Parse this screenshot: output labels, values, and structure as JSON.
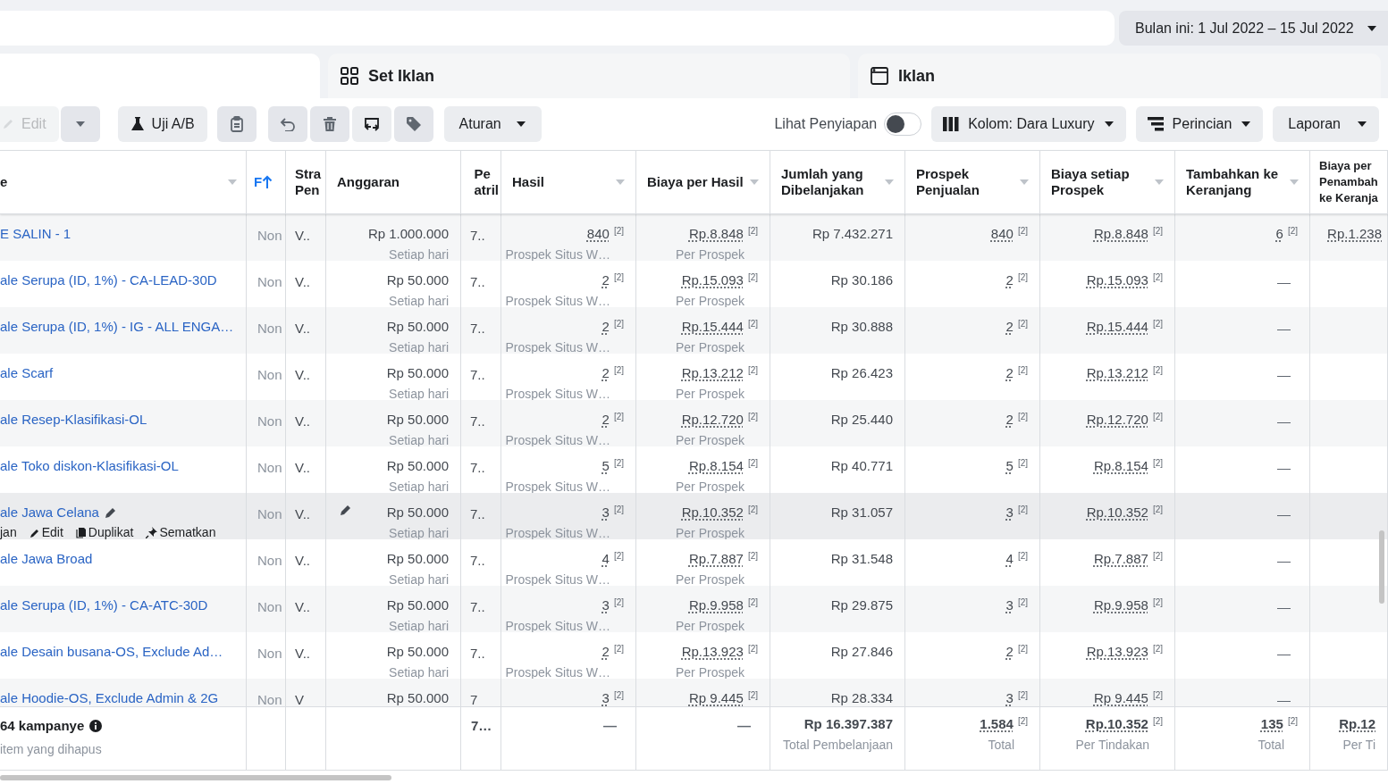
{
  "date_range": {
    "label": "Bulan ini: 1 Jul 2022 – 15 Jul 2022"
  },
  "tabs": [
    {
      "label": "Set Iklan"
    },
    {
      "label": "Iklan"
    }
  ],
  "toolbar": {
    "left": [
      {
        "kind": "edit",
        "label": "Edit",
        "disabled": true
      },
      {
        "kind": "caret",
        "disabled": false
      },
      {
        "kind": "abtest",
        "label": "Uji A/B",
        "disabled": false
      },
      {
        "kind": "clipboard",
        "disabled": false
      },
      {
        "kind": "undo",
        "disabled": false
      },
      {
        "kind": "trash",
        "disabled": false
      },
      {
        "kind": "swap",
        "disabled": false
      },
      {
        "kind": "tag",
        "disabled": false
      },
      {
        "kind": "dropdown",
        "label": "Aturan",
        "disabled": false
      }
    ],
    "setup_toggle": {
      "label": "Lihat Penyiapan",
      "on": false
    },
    "right": [
      {
        "label": "Kolom: Dara Luxury"
      },
      {
        "label": "Perincian"
      },
      {
        "label": "Laporan"
      }
    ]
  },
  "table": {
    "name_column": {
      "label": "e",
      "menu": true
    },
    "columns": [
      {
        "label": "F",
        "menu": false,
        "sorted": true
      },
      {
        "label": "Stra\nPen",
        "menu": false,
        "sorted": false
      },
      {
        "label": "Anggaran",
        "menu": false,
        "sorted": false
      },
      {
        "label": "Pe\natril",
        "menu": false,
        "sorted": false
      },
      {
        "label": "Hasil",
        "menu": true,
        "sorted": false
      },
      {
        "label": "Biaya per Hasil",
        "menu": true,
        "sorted": false
      },
      {
        "label": "Jumlah yang\nDibelanjakan",
        "menu": true,
        "sorted": false
      },
      {
        "label": "Prospek\nPenjualan",
        "menu": true,
        "sorted": false
      },
      {
        "label": "Biaya setiap\nProspek",
        "menu": true,
        "sorted": false
      },
      {
        "label": "Tambahkan ke\nKeranjang",
        "menu": true,
        "sorted": false
      },
      {
        "label": "Biaya per\nPenambah\nke Keranja",
        "menu": false,
        "sorted": false
      }
    ],
    "rows": [
      {
        "name": "E SALIN - 1",
        "hovered": false,
        "cells": [
          {
            "kind": "status",
            "text": "Non"
          },
          {
            "kind": "text",
            "text": "V.."
          },
          {
            "kind": "budget",
            "text": "Rp 1.000.000",
            "sub": "Setiap hari"
          },
          {
            "kind": "text",
            "text": "7.."
          },
          {
            "kind": "metric",
            "text": "840",
            "note": "[2]",
            "sub": "Prospek Situs W…"
          },
          {
            "kind": "metric",
            "text": "Rp.8.848",
            "note": "[2]",
            "sub": "Per Prospek"
          },
          {
            "kind": "amount",
            "text": "Rp 7.432.271"
          },
          {
            "kind": "metric",
            "text": "840",
            "note": "[2]"
          },
          {
            "kind": "metric",
            "text": "Rp.8.848",
            "note": "[2]"
          },
          {
            "kind": "metric",
            "text": "6",
            "note": "[2]"
          },
          {
            "kind": "metric",
            "text": "Rp.1.238"
          }
        ]
      },
      {
        "name": "ale Serupa (ID, 1%) - CA-LEAD-30D",
        "hovered": false,
        "cells": [
          {
            "kind": "status",
            "text": "Non"
          },
          {
            "kind": "text",
            "text": "V.."
          },
          {
            "kind": "budget",
            "text": "Rp 50.000",
            "sub": "Setiap hari"
          },
          {
            "kind": "text",
            "text": "7.."
          },
          {
            "kind": "metric",
            "text": "2",
            "note": "[2]",
            "sub": "Prospek Situs W…"
          },
          {
            "kind": "metric",
            "text": "Rp.15.093",
            "note": "[2]",
            "sub": "Per Prospek"
          },
          {
            "kind": "amount",
            "text": "Rp 30.186"
          },
          {
            "kind": "metric",
            "text": "2",
            "note": "[2]"
          },
          {
            "kind": "metric",
            "text": "Rp.15.093",
            "note": "[2]"
          },
          {
            "kind": "dash",
            "text": "—"
          },
          {
            "kind": "empty"
          }
        ]
      },
      {
        "name": "ale Serupa (ID, 1%) - IG - ALL ENGA…",
        "hovered": false,
        "cells": [
          {
            "kind": "status",
            "text": "Non"
          },
          {
            "kind": "text",
            "text": "V.."
          },
          {
            "kind": "budget",
            "text": "Rp 50.000",
            "sub": "Setiap hari"
          },
          {
            "kind": "text",
            "text": "7.."
          },
          {
            "kind": "metric",
            "text": "2",
            "note": "[2]",
            "sub": "Prospek Situs W…"
          },
          {
            "kind": "metric",
            "text": "Rp.15.444",
            "note": "[2]",
            "sub": "Per Prospek"
          },
          {
            "kind": "amount",
            "text": "Rp 30.888"
          },
          {
            "kind": "metric",
            "text": "2",
            "note": "[2]"
          },
          {
            "kind": "metric",
            "text": "Rp.15.444",
            "note": "[2]"
          },
          {
            "kind": "dash",
            "text": "—"
          },
          {
            "kind": "empty"
          }
        ]
      },
      {
        "name": "ale Scarf",
        "hovered": false,
        "cells": [
          {
            "kind": "status",
            "text": "Non"
          },
          {
            "kind": "text",
            "text": "V.."
          },
          {
            "kind": "budget",
            "text": "Rp 50.000",
            "sub": "Setiap hari"
          },
          {
            "kind": "text",
            "text": "7.."
          },
          {
            "kind": "metric",
            "text": "2",
            "note": "[2]",
            "sub": "Prospek Situs W…"
          },
          {
            "kind": "metric",
            "text": "Rp.13.212",
            "note": "[2]",
            "sub": "Per Prospek"
          },
          {
            "kind": "amount",
            "text": "Rp 26.423"
          },
          {
            "kind": "metric",
            "text": "2",
            "note": "[2]"
          },
          {
            "kind": "metric",
            "text": "Rp.13.212",
            "note": "[2]"
          },
          {
            "kind": "dash",
            "text": "—"
          },
          {
            "kind": "empty"
          }
        ]
      },
      {
        "name": "ale Resep-Klasifikasi-OL",
        "hovered": false,
        "cells": [
          {
            "kind": "status",
            "text": "Non"
          },
          {
            "kind": "text",
            "text": "V.."
          },
          {
            "kind": "budget",
            "text": "Rp 50.000",
            "sub": "Setiap hari"
          },
          {
            "kind": "text",
            "text": "7.."
          },
          {
            "kind": "metric",
            "text": "2",
            "note": "[2]",
            "sub": "Prospek Situs W…"
          },
          {
            "kind": "metric",
            "text": "Rp.12.720",
            "note": "[2]",
            "sub": "Per Prospek"
          },
          {
            "kind": "amount",
            "text": "Rp 25.440"
          },
          {
            "kind": "metric",
            "text": "2",
            "note": "[2]"
          },
          {
            "kind": "metric",
            "text": "Rp.12.720",
            "note": "[2]"
          },
          {
            "kind": "dash",
            "text": "—"
          },
          {
            "kind": "empty"
          }
        ]
      },
      {
        "name": "ale Toko diskon-Klasifikasi-OL",
        "hovered": false,
        "cells": [
          {
            "kind": "status",
            "text": "Non"
          },
          {
            "kind": "text",
            "text": "V.."
          },
          {
            "kind": "budget",
            "text": "Rp 50.000",
            "sub": "Setiap hari"
          },
          {
            "kind": "text",
            "text": "7.."
          },
          {
            "kind": "metric",
            "text": "5",
            "note": "[2]",
            "sub": "Prospek Situs W…"
          },
          {
            "kind": "metric",
            "text": "Rp.8.154",
            "note": "[2]",
            "sub": "Per Prospek"
          },
          {
            "kind": "amount",
            "text": "Rp 40.771"
          },
          {
            "kind": "metric",
            "text": "5",
            "note": "[2]"
          },
          {
            "kind": "metric",
            "text": "Rp.8.154",
            "note": "[2]"
          },
          {
            "kind": "dash",
            "text": "—"
          },
          {
            "kind": "empty"
          }
        ]
      },
      {
        "name": "ale Jawa Celana",
        "hovered": true,
        "actions": [
          "jan",
          "Edit",
          "Duplikat",
          "Sematkan"
        ],
        "cells": [
          {
            "kind": "status",
            "text": "Non"
          },
          {
            "kind": "text",
            "text": "V.."
          },
          {
            "kind": "budget",
            "text": "Rp 50.000",
            "sub": "Setiap hari"
          },
          {
            "kind": "text",
            "text": "7.."
          },
          {
            "kind": "metric",
            "text": "3",
            "note": "[2]",
            "sub": "Prospek Situs W…"
          },
          {
            "kind": "metric",
            "text": "Rp.10.352",
            "note": "[2]",
            "sub": "Per Prospek"
          },
          {
            "kind": "amount",
            "text": "Rp 31.057"
          },
          {
            "kind": "metric",
            "text": "3",
            "note": "[2]"
          },
          {
            "kind": "metric",
            "text": "Rp.10.352",
            "note": "[2]"
          },
          {
            "kind": "dash",
            "text": "—"
          },
          {
            "kind": "empty"
          }
        ]
      },
      {
        "name": "ale Jawa Broad",
        "hovered": false,
        "cells": [
          {
            "kind": "status",
            "text": "Non"
          },
          {
            "kind": "text",
            "text": "V.."
          },
          {
            "kind": "budget",
            "text": "Rp 50.000",
            "sub": "Setiap hari"
          },
          {
            "kind": "text",
            "text": "7.."
          },
          {
            "kind": "metric",
            "text": "4",
            "note": "[2]",
            "sub": "Prospek Situs W…"
          },
          {
            "kind": "metric",
            "text": "Rp.7.887",
            "note": "[2]",
            "sub": "Per Prospek"
          },
          {
            "kind": "amount",
            "text": "Rp 31.548"
          },
          {
            "kind": "metric",
            "text": "4",
            "note": "[2]"
          },
          {
            "kind": "metric",
            "text": "Rp.7.887",
            "note": "[2]"
          },
          {
            "kind": "dash",
            "text": "—"
          },
          {
            "kind": "empty"
          }
        ]
      },
      {
        "name": "ale Serupa (ID, 1%) - CA-ATC-30D",
        "hovered": false,
        "cells": [
          {
            "kind": "status",
            "text": "Non"
          },
          {
            "kind": "text",
            "text": "V.."
          },
          {
            "kind": "budget",
            "text": "Rp 50.000",
            "sub": "Setiap hari"
          },
          {
            "kind": "text",
            "text": "7.."
          },
          {
            "kind": "metric",
            "text": "3",
            "note": "[2]",
            "sub": "Prospek Situs W…"
          },
          {
            "kind": "metric",
            "text": "Rp.9.958",
            "note": "[2]",
            "sub": "Per Prospek"
          },
          {
            "kind": "amount",
            "text": "Rp 29.875"
          },
          {
            "kind": "metric",
            "text": "3",
            "note": "[2]"
          },
          {
            "kind": "metric",
            "text": "Rp.9.958",
            "note": "[2]"
          },
          {
            "kind": "dash",
            "text": "—"
          },
          {
            "kind": "empty"
          }
        ]
      },
      {
        "name": "ale Desain busana-OS, Exclude Ad…",
        "hovered": false,
        "cells": [
          {
            "kind": "status",
            "text": "Non"
          },
          {
            "kind": "text",
            "text": "V.."
          },
          {
            "kind": "budget",
            "text": "Rp 50.000",
            "sub": "Setiap hari"
          },
          {
            "kind": "text",
            "text": "7.."
          },
          {
            "kind": "metric",
            "text": "2",
            "note": "[2]",
            "sub": "Prospek Situs W…"
          },
          {
            "kind": "metric",
            "text": "Rp.13.923",
            "note": "[2]",
            "sub": "Per Prospek"
          },
          {
            "kind": "amount",
            "text": "Rp 27.846"
          },
          {
            "kind": "metric",
            "text": "2",
            "note": "[2]"
          },
          {
            "kind": "metric",
            "text": "Rp.13.923",
            "note": "[2]"
          },
          {
            "kind": "dash",
            "text": "—"
          },
          {
            "kind": "empty"
          }
        ]
      },
      {
        "name": "ale Hoodie-OS, Exclude Admin & 2G",
        "hovered": false,
        "cells": [
          {
            "kind": "status",
            "text": "Non"
          },
          {
            "kind": "text",
            "text": "V"
          },
          {
            "kind": "budget",
            "text": "Rp 50.000"
          },
          {
            "kind": "text",
            "text": "7"
          },
          {
            "kind": "metric",
            "text": "3",
            "note": "[2]"
          },
          {
            "kind": "metric",
            "text": "Rp 9.445",
            "note": "[2]"
          },
          {
            "kind": "amount",
            "text": "Rp 28.334"
          },
          {
            "kind": "metric",
            "text": "3",
            "note": "[2]"
          },
          {
            "kind": "metric",
            "text": "Rp 9.445",
            "note": "[2]"
          },
          {
            "kind": "dash",
            "text": "—"
          },
          {
            "kind": "empty"
          }
        ]
      }
    ],
    "totals": {
      "name": "64 kampanye",
      "sub": "item yang dihapus",
      "cells": [
        {
          "kind": "empty"
        },
        {
          "kind": "empty"
        },
        {
          "kind": "empty"
        },
        {
          "kind": "text",
          "text": "7…"
        },
        {
          "kind": "dash",
          "text": "—"
        },
        {
          "kind": "dash",
          "text": "—"
        },
        {
          "kind": "amount",
          "text": "Rp 16.397.387",
          "sub": "Total Pembelanjaan"
        },
        {
          "kind": "metric",
          "text": "1.584",
          "note": "[2]",
          "sub": "Total"
        },
        {
          "kind": "metric",
          "text": "Rp.10.352",
          "note": "[2]",
          "sub": "Per Tindakan"
        },
        {
          "kind": "metric",
          "text": "135",
          "note": "[2]",
          "sub": "Total"
        },
        {
          "kind": "metric",
          "text": "Rp.12",
          "sub": "Per Ti"
        }
      ]
    }
  }
}
